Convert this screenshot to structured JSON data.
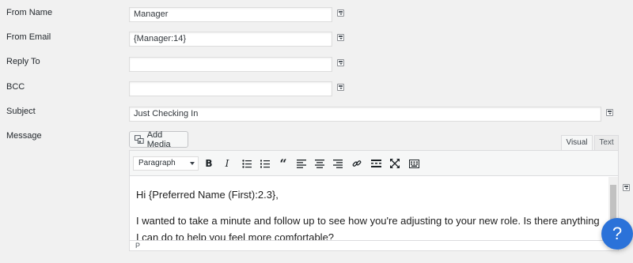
{
  "form": {
    "from_name": {
      "label": "From Name",
      "value": "Manager"
    },
    "from_email": {
      "label": "From Email",
      "value": "{Manager:14}"
    },
    "reply_to": {
      "label": "Reply To",
      "value": ""
    },
    "bcc": {
      "label": "BCC",
      "value": ""
    },
    "subject": {
      "label": "Subject",
      "value": "Just Checking In"
    },
    "message": {
      "label": "Message"
    }
  },
  "editor": {
    "add_media_label": "Add Media",
    "tabs": {
      "visual": "Visual",
      "text": "Text"
    },
    "format_select": "Paragraph",
    "toolbar_icons": [
      "bold-icon",
      "italic-icon",
      "bulleted-list-icon",
      "numbered-list-icon",
      "blockquote-icon",
      "align-left-icon",
      "align-center-icon",
      "align-right-icon",
      "link-icon",
      "read-more-icon",
      "fullscreen-icon",
      "toolbar-toggle-icon"
    ],
    "content": {
      "greeting": "Hi {Preferred Name (First):2.3},",
      "body": "I wanted to take a minute and follow up to see how you're adjusting to your new role. Is there anything I can do to help you feel more comfortable?"
    },
    "status_path": "P"
  },
  "help": {
    "icon": "?"
  },
  "colors": {
    "accent": "#2b72d9",
    "background": "#f1f1f1"
  }
}
